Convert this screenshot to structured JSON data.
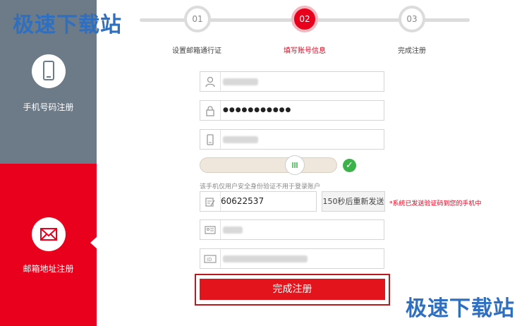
{
  "watermark_text": "极速下载站",
  "sidebar": {
    "phone_label": "手机号码注册",
    "email_label": "邮箱地址注册"
  },
  "steps": [
    {
      "num": "01",
      "label": "设置邮箱通行证"
    },
    {
      "num": "02",
      "label": "填写账号信息"
    },
    {
      "num": "03",
      "label": "完成注册"
    }
  ],
  "form": {
    "password_mask": "●●●●●●●●●●●",
    "phone_hint": "该手机仅用户安全身份验证不用于登录账户",
    "sms_code": "60622537",
    "resend_label": "150秒后重新发送",
    "sent_notice": "*系统已发送验证码到您的手机中",
    "submit_label": "完成注册"
  },
  "colors": {
    "accent": "#e8001c",
    "sidebar_gray": "#6c7b87",
    "success": "#3cb34a",
    "watermark": "#2e6fc2"
  }
}
